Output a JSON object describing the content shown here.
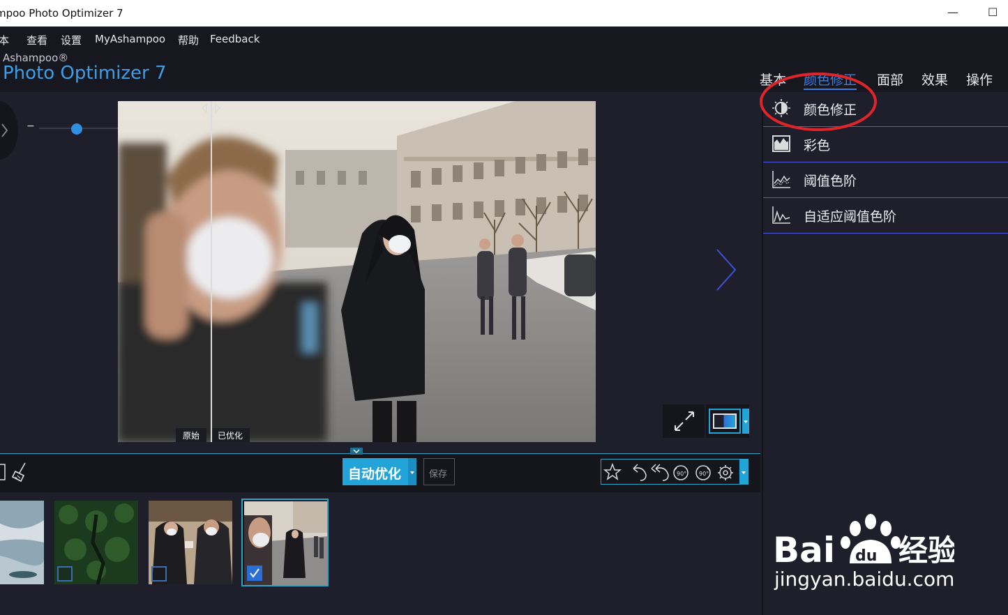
{
  "window": {
    "title": "mpoo Photo Optimizer 7",
    "minimize": "—",
    "maximize": "☐"
  },
  "menu": {
    "items": [
      "本",
      "查看",
      "设置",
      "MyAshampoo",
      "帮助",
      "Feedback"
    ]
  },
  "brand": {
    "vendor": "Ashampoo®",
    "product": "Photo Optimizer 7"
  },
  "tabs": [
    {
      "label": "基本",
      "active": false
    },
    {
      "label": "颜色修正",
      "active": true
    },
    {
      "label": "面部",
      "active": false
    },
    {
      "label": "效果",
      "active": false
    },
    {
      "label": "操作",
      "active": false
    }
  ],
  "panel": {
    "items": [
      {
        "label": "颜色修正",
        "icon": "brightness-icon"
      },
      {
        "label": "彩色",
        "icon": "color-icon"
      },
      {
        "label": "阈值色阶",
        "icon": "levels-icon"
      },
      {
        "label": "自适应阈值色阶",
        "icon": "adaptive-levels-icon"
      }
    ]
  },
  "viewer": {
    "zoom_minus": "−",
    "zoom_plus": "+",
    "zoom_level": 0.4,
    "label_original": "原始",
    "label_optimized": "已优化"
  },
  "toolbar": {
    "auto_label": "自动优化",
    "save_label": "保存"
  },
  "thumbnails": [
    {
      "checked": false,
      "has_checkbox": false
    },
    {
      "checked": false,
      "has_checkbox": true
    },
    {
      "checked": false,
      "has_checkbox": true
    },
    {
      "checked": true,
      "has_checkbox": true,
      "selected": true
    }
  ],
  "watermark": {
    "brand": "Bai  经验",
    "url": "jingyan.baidu.com"
  },
  "colors": {
    "accent": "#3b7ee8",
    "cyan": "#23a4d8",
    "annotation": "#e0252a"
  }
}
